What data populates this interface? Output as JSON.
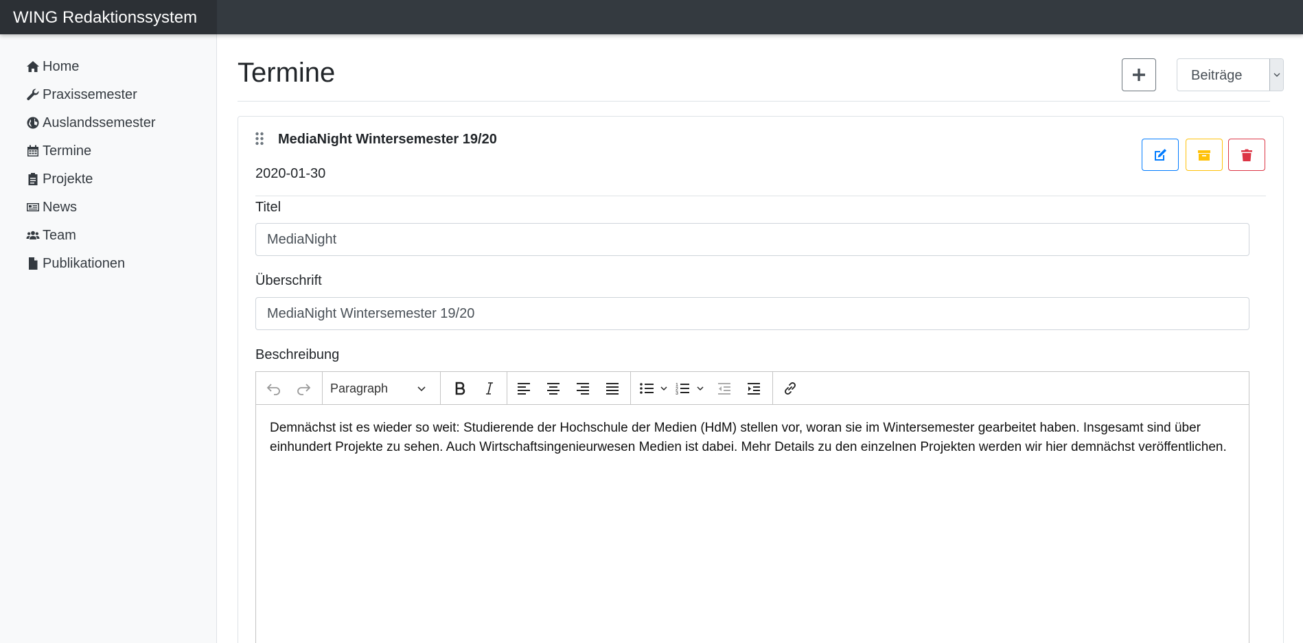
{
  "navbar": {
    "brand": "WING Redaktionssystem",
    "background": "#343a40"
  },
  "sidebar": {
    "items": [
      {
        "label": "Home",
        "icon": "home-icon"
      },
      {
        "label": "Praxissemester",
        "icon": "wrench-icon"
      },
      {
        "label": "Auslandssemester",
        "icon": "globe-icon"
      },
      {
        "label": "Termine",
        "icon": "calendar-icon"
      },
      {
        "label": "Projekte",
        "icon": "clipboard-icon"
      },
      {
        "label": "News",
        "icon": "newspaper-icon"
      },
      {
        "label": "Team",
        "icon": "users-icon"
      },
      {
        "label": "Publikationen",
        "icon": "file-icon"
      }
    ]
  },
  "main": {
    "title": "Termine",
    "add_icon": "plus-icon",
    "select": {
      "value": "Beiträge"
    }
  },
  "card": {
    "title": "MediaNight Wintersemester 19/20",
    "date": "2020-01-30",
    "actions": [
      {
        "icon": "edit-icon",
        "color": "#007bff"
      },
      {
        "icon": "archive-icon",
        "color": "#ffc107"
      },
      {
        "icon": "trash-icon",
        "color": "#dc3545"
      }
    ],
    "fields": {
      "titel_label": "Titel",
      "titel_value": "MediaNight",
      "ueberschrift_label": "Überschrift",
      "ueberschrift_value": "MediaNight Wintersemester 19/20",
      "beschreibung_label": "Beschreibung"
    },
    "editor": {
      "heading_select": "Paragraph",
      "body": "Demnächst ist es wieder so weit: Studierende der Hochschule der Medien (HdM) stellen vor, woran sie im Wintersemester gearbeitet haben. Insgesamt sind über einhundert Projekte zu sehen. Auch Wirtschaftsingenieurwesen Medien ist dabei. Mehr Details zu den einzelnen Projekten werden wir hier demnächst veröffentlichen."
    }
  }
}
